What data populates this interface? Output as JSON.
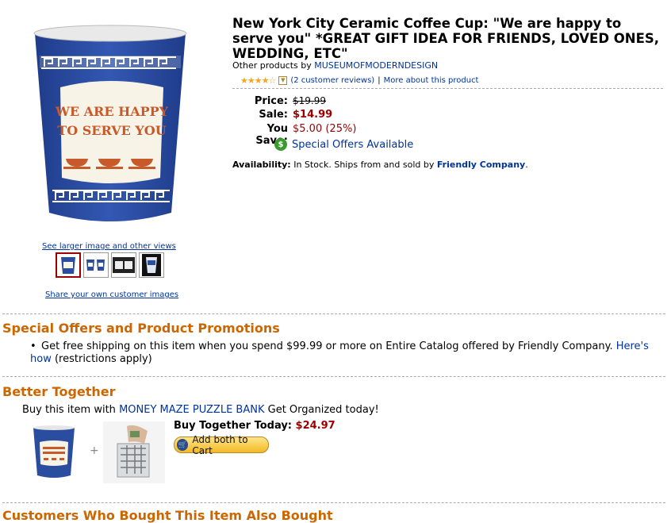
{
  "product": {
    "title": "New York City Ceramic Coffee Cup: \"We are happy to serve you\" *GREAT GIFT IDEA FOR FRIENDS, LOVED ONES, WEDDING, ETC\"",
    "byline_prefix": "Other products by",
    "brand": "MUSEUMOFMODERNDESIGN",
    "stars": "★★★★☆",
    "reviews_link": "(2 customer reviews)",
    "separator": "|",
    "more_about": "More about this product",
    "price_label": "Price:",
    "price": "$19.99",
    "sale_label": "Sale:",
    "sale": "$14.99",
    "save_label": "You Save:",
    "save": "$5.00 (25%)",
    "special_offers": "Special Offers Available",
    "availability_label": "Availability:",
    "availability_text": "In Stock. Ships from and sold by",
    "seller": "Friendly Company",
    "availability_end": ".",
    "cup_text_1": "WE ARE HAPPY",
    "cup_text_2": "TO SERVE YOU"
  },
  "images": {
    "see_larger": "See larger image and other views",
    "share": "Share your own customer images"
  },
  "offers": {
    "heading": "Special Offers and Product Promotions",
    "bullet_text": "Get free shipping on this item when you spend $99.99 or more on Entire Catalog offered by Friendly Company.",
    "bullet_link": "Here's how",
    "bullet_end": "(restrictions apply)"
  },
  "together": {
    "heading": "Better Together",
    "buy_prefix": "Buy this item with",
    "item_link": "MONEY MAZE PUZZLE BANK",
    "buy_suffix": "Get Organized today!",
    "plus": "+",
    "buy_today_label": "Buy Together Today:",
    "buy_today_price": "$24.97",
    "add_button": "Add both to Cart"
  },
  "next_heading": "Customers Who Bought This Item Also Bought",
  "colors": {
    "accent": "#cc6600",
    "price": "#990000",
    "link": "#003399",
    "cup_blue": "#2b4da0"
  }
}
